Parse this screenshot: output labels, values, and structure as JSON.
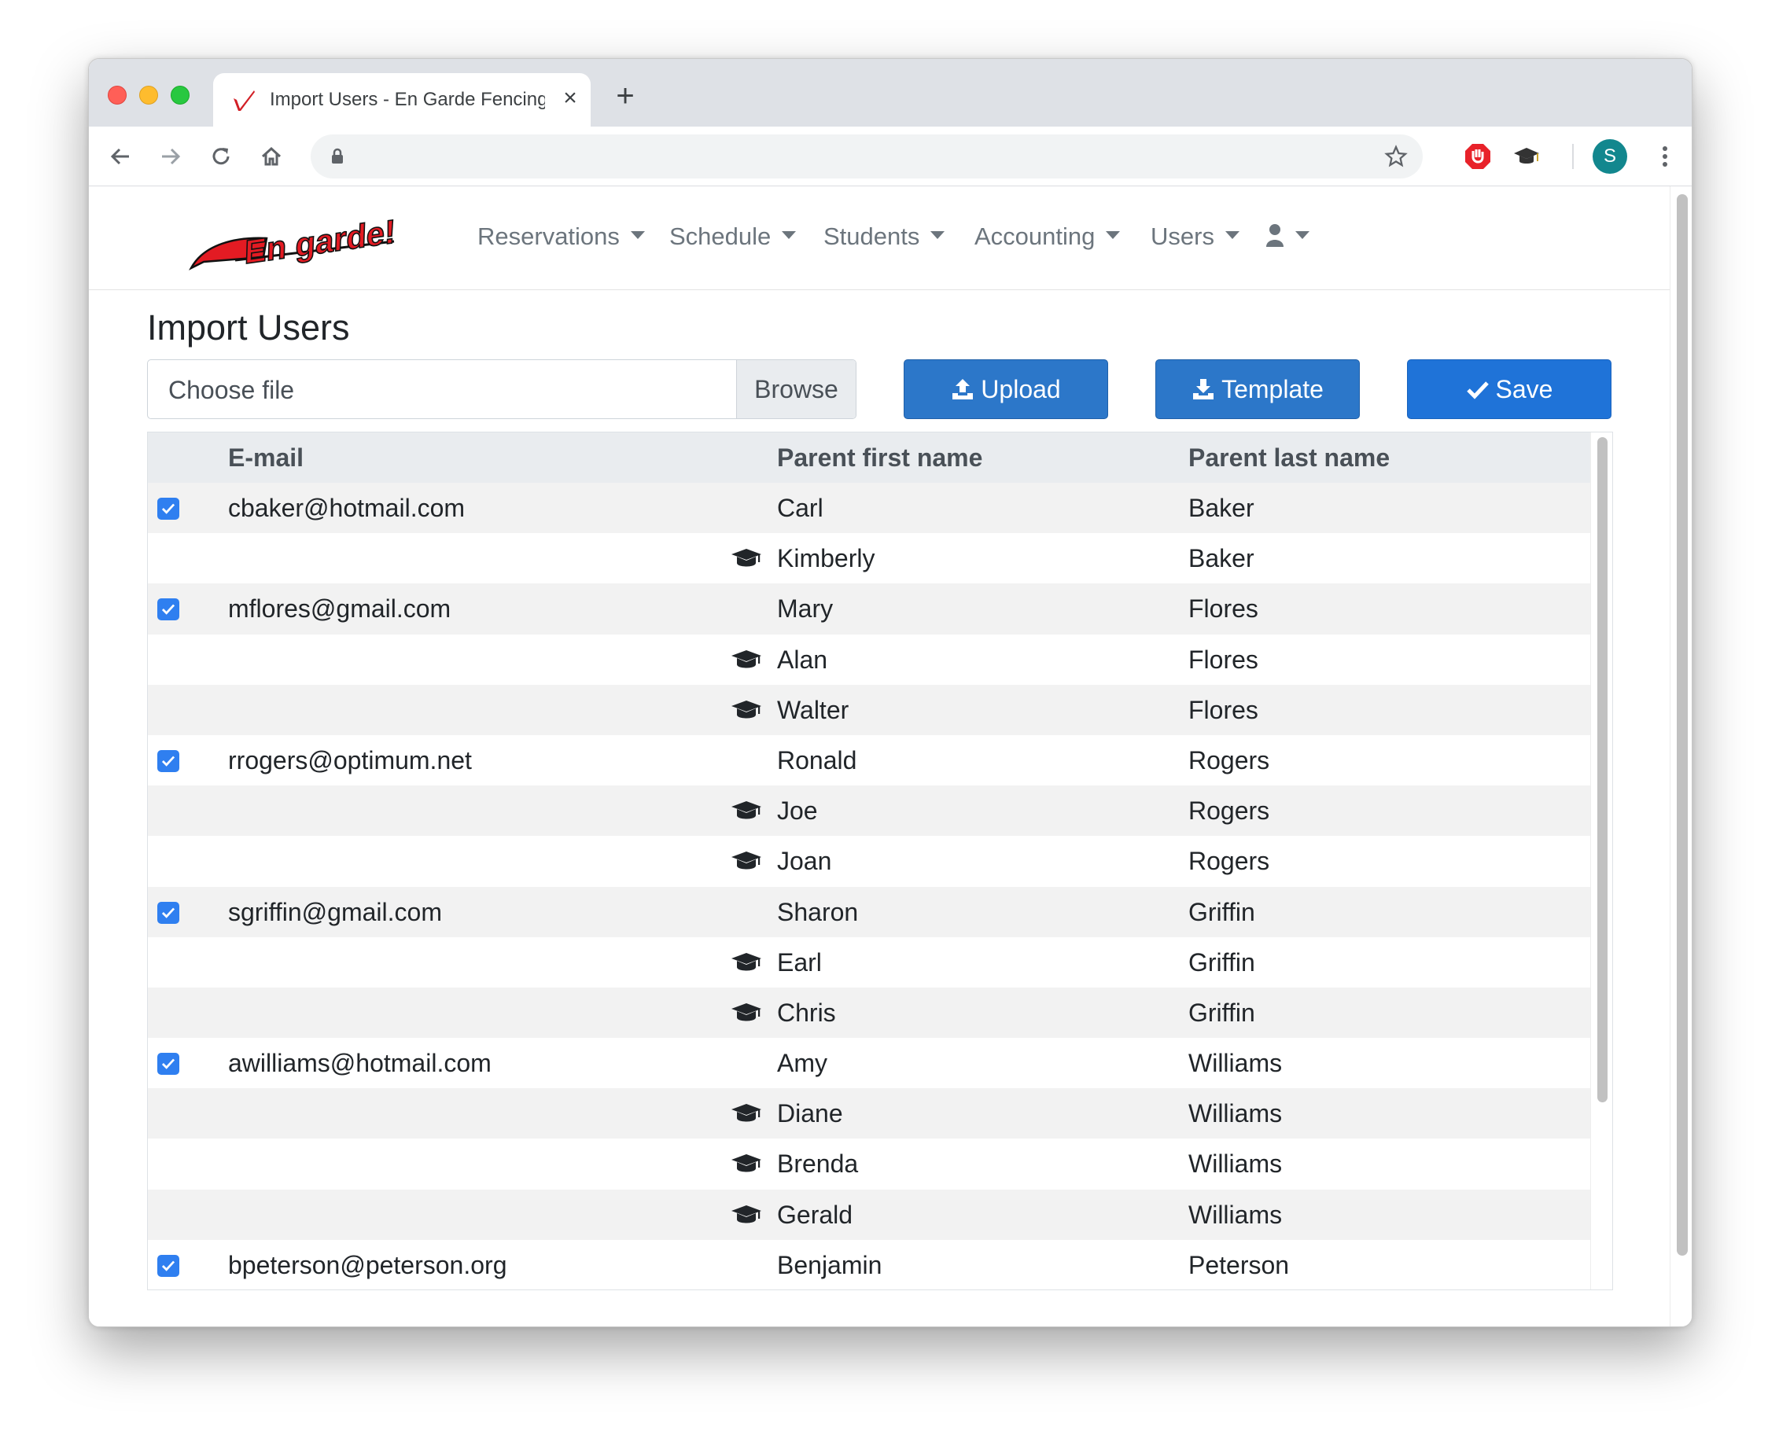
{
  "browser": {
    "tab_title": "Import Users - En Garde Fencing",
    "new_tab_label": "+",
    "close_tab_label": "×",
    "profile_initial": "S"
  },
  "logo_text": "En garde!",
  "nav": {
    "items": [
      {
        "label": "Reservations"
      },
      {
        "label": "Schedule"
      },
      {
        "label": "Students"
      },
      {
        "label": "Accounting"
      },
      {
        "label": "Users"
      }
    ]
  },
  "page": {
    "title": "Import Users"
  },
  "file_input": {
    "placeholder": "Choose file",
    "browse_label": "Browse"
  },
  "buttons": {
    "upload": "Upload",
    "template": "Template",
    "save": "Save"
  },
  "table": {
    "columns": [
      "E-mail",
      "Parent first name",
      "Parent last name"
    ],
    "rows": [
      {
        "checked": true,
        "email": "cbaker@hotmail.com",
        "first": "Carl",
        "last": "Baker",
        "student": false
      },
      {
        "checked": false,
        "email": "",
        "first": "Kimberly",
        "last": "Baker",
        "student": true
      },
      {
        "checked": true,
        "email": "mflores@gmail.com",
        "first": "Mary",
        "last": "Flores",
        "student": false
      },
      {
        "checked": false,
        "email": "",
        "first": "Alan",
        "last": "Flores",
        "student": true
      },
      {
        "checked": false,
        "email": "",
        "first": "Walter",
        "last": "Flores",
        "student": true
      },
      {
        "checked": true,
        "email": "rrogers@optimum.net",
        "first": "Ronald",
        "last": "Rogers",
        "student": false
      },
      {
        "checked": false,
        "email": "",
        "first": "Joe",
        "last": "Rogers",
        "student": true
      },
      {
        "checked": false,
        "email": "",
        "first": "Joan",
        "last": "Rogers",
        "student": true
      },
      {
        "checked": true,
        "email": "sgriffin@gmail.com",
        "first": "Sharon",
        "last": "Griffin",
        "student": false
      },
      {
        "checked": false,
        "email": "",
        "first": "Earl",
        "last": "Griffin",
        "student": true
      },
      {
        "checked": false,
        "email": "",
        "first": "Chris",
        "last": "Griffin",
        "student": true
      },
      {
        "checked": true,
        "email": "awilliams@hotmail.com",
        "first": "Amy",
        "last": "Williams",
        "student": false
      },
      {
        "checked": false,
        "email": "",
        "first": "Diane",
        "last": "Williams",
        "student": true
      },
      {
        "checked": false,
        "email": "",
        "first": "Brenda",
        "last": "Williams",
        "student": true
      },
      {
        "checked": false,
        "email": "",
        "first": "Gerald",
        "last": "Williams",
        "student": true
      },
      {
        "checked": true,
        "email": "bpeterson@peterson.org",
        "first": "Benjamin",
        "last": "Peterson",
        "student": false
      }
    ]
  },
  "colors": {
    "primary": "#2c77c9",
    "save": "#1f73d8",
    "checkbox": "#2f7ff0",
    "logo_red": "#e31b23"
  }
}
